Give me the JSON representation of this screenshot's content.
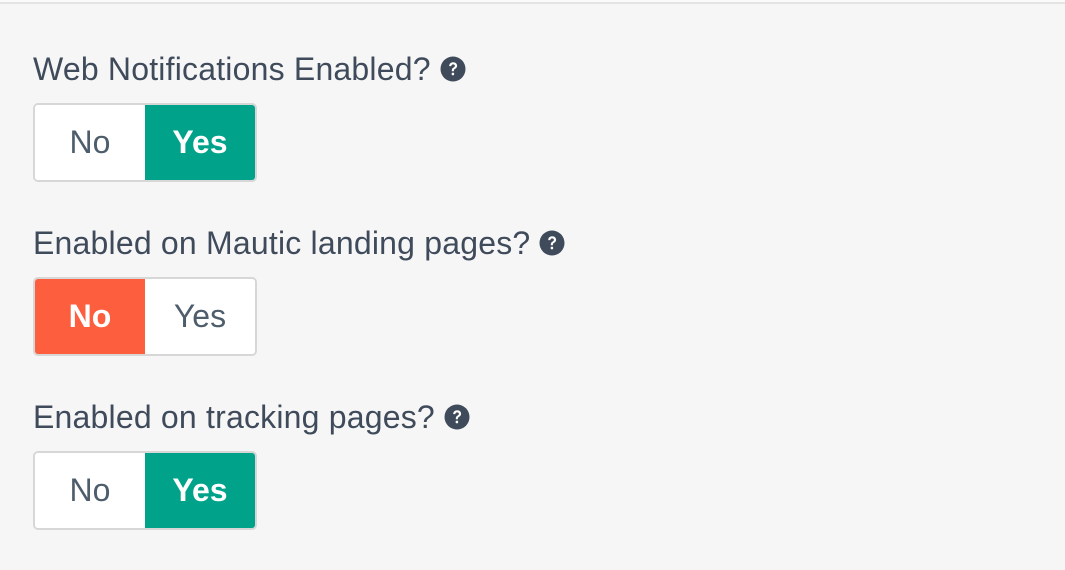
{
  "settings": [
    {
      "label": "Web Notifications Enabled?",
      "help_icon": "question-circle-icon",
      "options": [
        "No",
        "Yes"
      ],
      "selected": "Yes"
    },
    {
      "label": "Enabled on Mautic landing pages?",
      "help_icon": "question-circle-icon",
      "options": [
        "No",
        "Yes"
      ],
      "selected": "No"
    },
    {
      "label": "Enabled on tracking pages?",
      "help_icon": "question-circle-icon",
      "options": [
        "No",
        "Yes"
      ],
      "selected": "Yes"
    }
  ],
  "colors": {
    "yes_active": "#00a38a",
    "no_active": "#fd5e3e",
    "label_text": "#3f4b5b",
    "inactive_text": "#4e5d6c"
  }
}
